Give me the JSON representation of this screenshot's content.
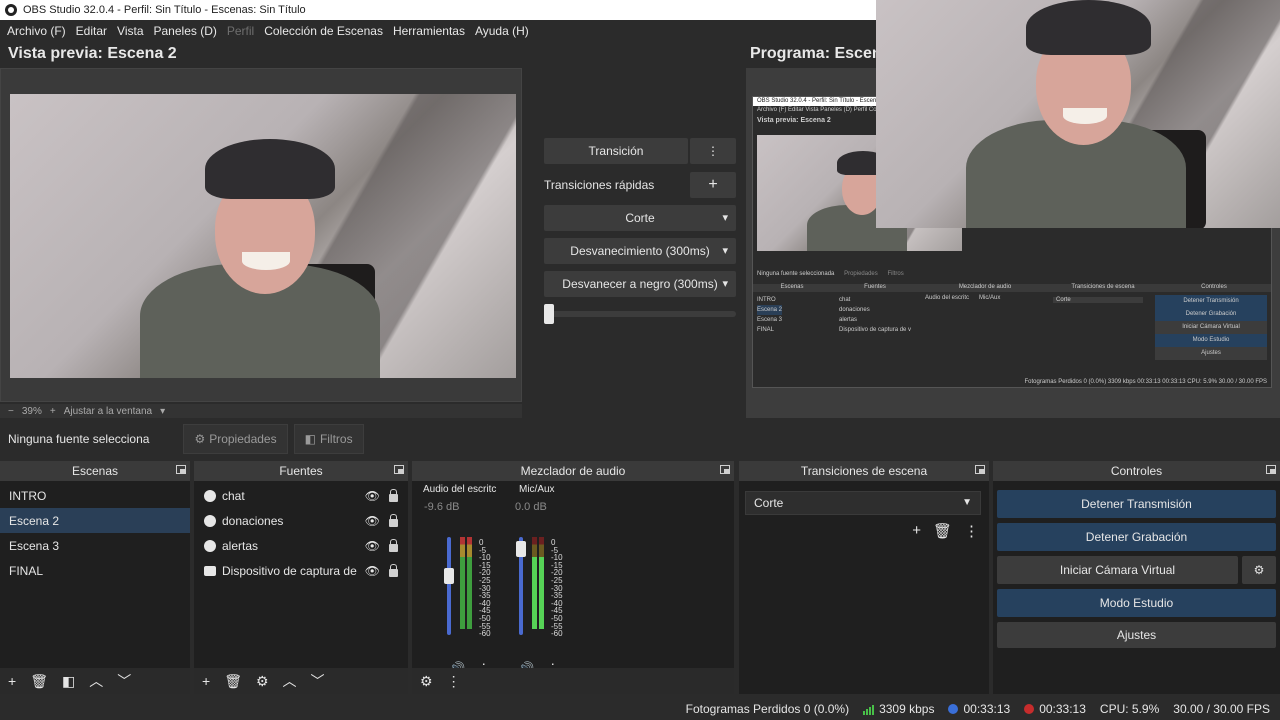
{
  "window": {
    "title": "OBS Studio 32.0.4 - Perfil: Sin Título - Escenas: Sin Título"
  },
  "menu": [
    "Archivo (F)",
    "Editar",
    "Vista",
    "Paneles (D)",
    "Perfil",
    "Colección de Escenas",
    "Herramientas",
    "Ayuda (H)"
  ],
  "preview": {
    "title": "Vista previa: Escena 2",
    "zoom": "39%",
    "fit_label": "Ajustar a la ventana"
  },
  "program": {
    "title": "Programa: Escena 2"
  },
  "transition_panel": {
    "transition_label": "Transición",
    "quick_label": "Transiciones rápidas",
    "options": [
      "Corte",
      "Desvanecimiento (300ms)",
      "Desvanecer a negro (300ms)"
    ],
    "slider_value": 0
  },
  "source_bar": {
    "none_selected": "Ninguna fuente selecciona",
    "properties": "Propiedades",
    "filters": "Filtros"
  },
  "docks": {
    "scenes": {
      "title": "Escenas",
      "items": [
        "INTRO",
        "Escena 2",
        "Escena 3",
        "FINAL"
      ],
      "selected": "Escena 2"
    },
    "sources": {
      "title": "Fuentes",
      "items": [
        "chat",
        "donaciones",
        "alertas",
        "Dispositivo de captura de v"
      ]
    },
    "mixer": {
      "title": "Mezclador de audio",
      "channels": [
        {
          "name": "Audio del escritc",
          "db": "-9.6 dB",
          "fader": 0.62
        },
        {
          "name": "Mic/Aux",
          "db": "0.0 dB",
          "fader": 0.95
        }
      ],
      "scale": [
        "0",
        "-5",
        "-10",
        "-15",
        "-20",
        "-25",
        "-30",
        "-35",
        "-40",
        "-45",
        "-50",
        "-55",
        "-60"
      ]
    },
    "transitions": {
      "title": "Transiciones de escena",
      "selected": "Corte"
    },
    "controls": {
      "title": "Controles",
      "stop_stream": "Detener Transmisión",
      "stop_record": "Detener Grabación",
      "virtual_cam": "Iniciar Cámara Virtual",
      "studio_mode": "Modo Estudio",
      "settings": "Ajustes"
    }
  },
  "status": {
    "dropped": "Fotogramas Perdidos 0 (0.0%)",
    "bitrate": "3309 kbps",
    "stream_time": "00:33:13",
    "rec_time": "00:33:13",
    "cpu": "CPU: 5.9%",
    "fps": "30.00 / 30.00 FPS"
  },
  "colors": {
    "accent": "#26415e",
    "selected": "#2a3f57",
    "rec": "#c62c2c",
    "meter": "#3e9e3e"
  },
  "mini_screen": {
    "title": "OBS Studio 32.0.4 - Perfil: Sin Título - Escenas: Sin Título",
    "menu": "Archivo (F)   Editar   Vista   Paneles (D)   Perfil   Colección",
    "preview_title": "Vista previa: Escena 2",
    "none_selected": "Ninguna fuente seleccionada",
    "properties": "Propiedades",
    "filters": "Filtros",
    "docks": [
      "Escenas",
      "Fuentes",
      "Mezclador de audio",
      "Transiciones de escena",
      "Controles"
    ],
    "scenes": [
      "INTRO",
      "Escena 2",
      "Escena 3",
      "FINAL"
    ],
    "sources": [
      "chat",
      "donaciones",
      "alertas",
      "Dispositivo de captura de v"
    ],
    "mixer_names": [
      "Audio del escritc",
      "Mic/Aux"
    ],
    "transition": "Corte",
    "controls": [
      "Detener Transmisión",
      "Detener Grabación",
      "Iniciar Cámara Virtual",
      "Modo Estudio",
      "Ajustes"
    ],
    "status": "Fotogramas Perdidos 0 (0.0%)   3309 kbps   00:33:13   00:33:13   CPU: 5.9%   30.00 / 30.00 FPS"
  }
}
